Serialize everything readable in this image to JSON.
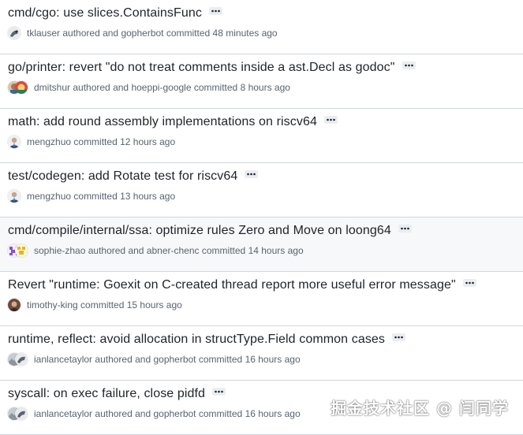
{
  "commits": [
    {
      "title": "cmd/cgo: use slices.ContainsFunc",
      "author": "tklauser",
      "committer": "gopherbot",
      "committed_time": "48 minutes ago",
      "authored_label": "authored and",
      "committed_label": "committed"
    },
    {
      "title": "go/printer: revert \"do not treat comments inside a ast.Decl as godoc\"",
      "author": "dmitshur",
      "committer": "hoeppi-google",
      "committed_time": "8 hours ago",
      "authored_label": "authored and",
      "committed_label": "committed"
    },
    {
      "title": "math: add round assembly implementations on riscv64",
      "author": "mengzhuo",
      "committer": "",
      "committed_time": "12 hours ago",
      "authored_label": "",
      "committed_label": "committed"
    },
    {
      "title": "test/codegen: add Rotate test for riscv64",
      "author": "mengzhuo",
      "committer": "",
      "committed_time": "13 hours ago",
      "authored_label": "",
      "committed_label": "committed"
    },
    {
      "title": "cmd/compile/internal/ssa: optimize rules Zero and Move on loong64",
      "author": "sophie-zhao",
      "committer": "abner-chenc",
      "committed_time": "14 hours ago",
      "authored_label": "authored and",
      "committed_label": "committed"
    },
    {
      "title": "Revert \"runtime: Goexit on C-created thread report more useful error message\"",
      "author": "timothy-king",
      "committer": "",
      "committed_time": "15 hours ago",
      "authored_label": "",
      "committed_label": "committed"
    },
    {
      "title": "runtime, reflect: avoid allocation in structType.Field common cases",
      "author": "ianlancetaylor",
      "committer": "gopherbot",
      "committed_time": "16 hours ago",
      "authored_label": "authored and",
      "committed_label": "committed"
    },
    {
      "title": "syscall: on exec failure, close pidfd",
      "author": "ianlancetaylor",
      "committer": "gopherbot",
      "committed_time": "16 hours ago",
      "authored_label": "authored and",
      "committed_label": "committed"
    }
  ],
  "watermark": "掘金技术社区 @ 闫同学",
  "icons": {
    "more": "kebab-horizontal-icon",
    "avatar": "user-avatar-icon"
  },
  "colors": {
    "text": "#1f2328",
    "muted": "#59636e",
    "border": "#d0d7de",
    "highlight": "#f6f8fa",
    "ellipsis_bg": "#eaeef2"
  }
}
